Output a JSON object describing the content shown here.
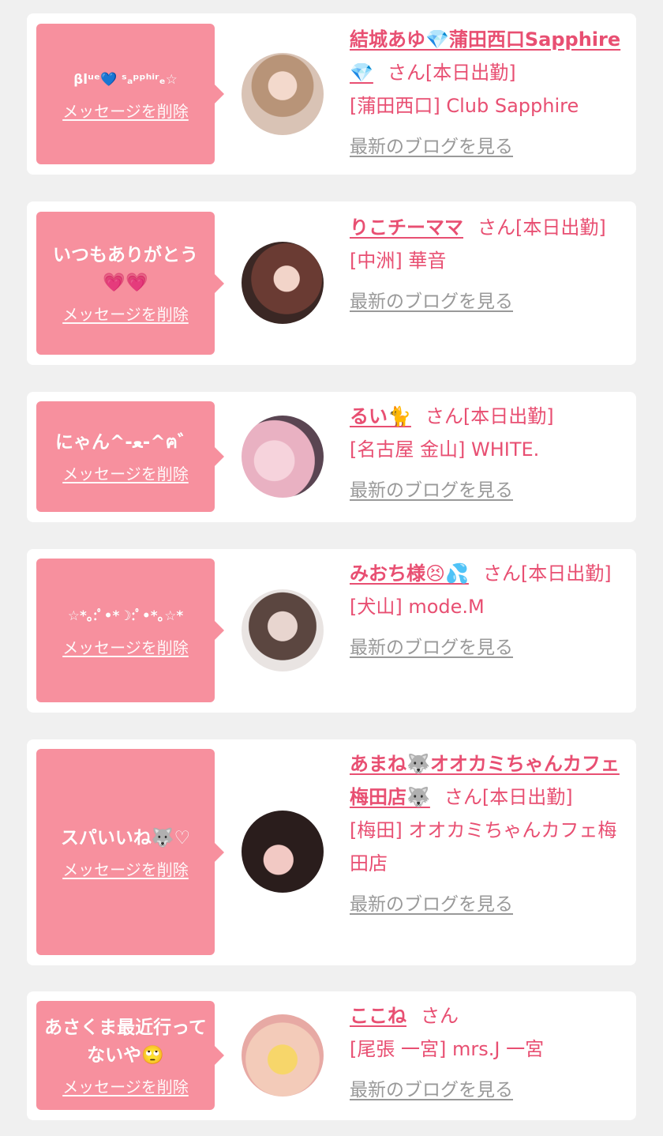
{
  "delete_label": "メッセージを削除",
  "blog_label": "最新のブログを見る",
  "cards": [
    {
      "message": "βlᵘᵉ💙 ˢₐᵖᵖʰⁱʳₑ☆",
      "name": "結城あゆ💎蒲田西口Sapphire💎",
      "suffix": "さん[本日出勤]",
      "shop": "[蒲田西口] Club Sapphire"
    },
    {
      "message": "いつもありがとう💗💗",
      "name": "りこチーママ",
      "suffix": "さん[本日出勤]",
      "shop": "[中洲] 華音"
    },
    {
      "message": "にゃん^-ﻌ-^ฅ゛",
      "name": "るい🐈",
      "suffix": "さん[本日出勤]",
      "shop": "[名古屋 金山] WHITE."
    },
    {
      "message": "☆*｡:ﾟ•*☽:ﾟ•*｡☆*",
      "name": "みおち様😣💦",
      "suffix": "さん[本日出勤]",
      "shop": "[犬山] mode.M"
    },
    {
      "message": "スパいいね🐺♡",
      "name": "あまね🐺オオカミちゃんカフェ梅田店🐺",
      "suffix": "さん[本日出勤]",
      "shop": "[梅田] オオカミちゃんカフェ梅田店"
    },
    {
      "message": "あさくま最近行ってないや🙄",
      "name": "ここね",
      "suffix": "さん",
      "shop": "[尾張 一宮] mrs.J 一宮"
    }
  ],
  "colors": {
    "accent": "#e84f72",
    "bubble": "#f7909e",
    "muted": "#999999",
    "background": "#f0f0f0"
  }
}
